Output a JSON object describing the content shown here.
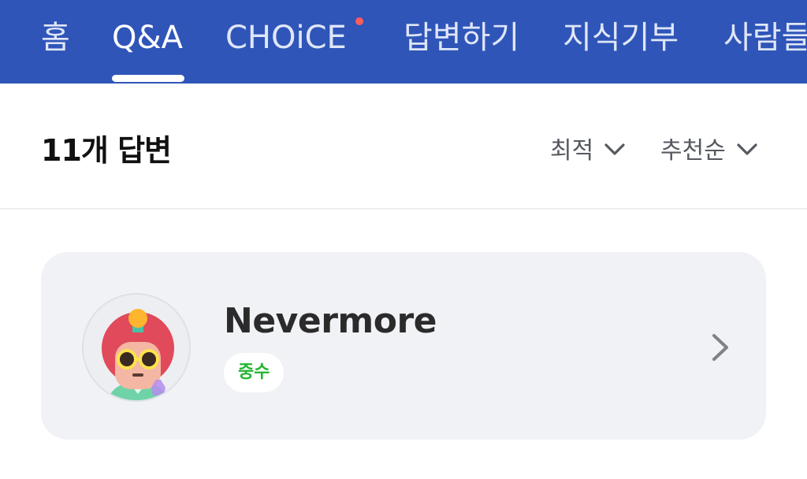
{
  "nav": {
    "tabs": [
      {
        "label": "홈"
      },
      {
        "label": "Q&A"
      },
      {
        "label": "CHOiCE"
      },
      {
        "label": "답변하기"
      },
      {
        "label": "지식기부"
      },
      {
        "label": "사람들"
      }
    ]
  },
  "answers": {
    "count_title": "11개 답변",
    "filter_1": "최적",
    "filter_2": "추천순"
  },
  "card": {
    "username": "Nevermore",
    "rank": "중수"
  },
  "colors": {
    "nav_bg": "#2f55b8",
    "rank_green": "#22b52f",
    "new_dot": "#ff5c5c"
  },
  "icons": {
    "filter_chevron": "chevron-down-icon",
    "card_chevron": "chevron-right-icon"
  }
}
